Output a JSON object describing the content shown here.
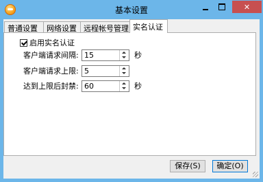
{
  "window": {
    "title": "基本设置",
    "controls": {
      "minimize_label": "",
      "maximize_label": "",
      "close_label": "✕"
    }
  },
  "tabs": [
    {
      "label": "普通设置"
    },
    {
      "label": "网络设置"
    },
    {
      "label": "远程帐号管理"
    },
    {
      "label": "实名认证"
    }
  ],
  "active_tab": "实名认证",
  "realname": {
    "enable_label": "启用实名认证",
    "enabled": true,
    "fields": [
      {
        "label": "客户端请求间隔:",
        "value": "15",
        "unit": "秒"
      },
      {
        "label": "客户端请求上限:",
        "value": "5",
        "unit": ""
      },
      {
        "label": "达到上限后封禁:",
        "value": "60",
        "unit": "秒"
      }
    ]
  },
  "buttons": {
    "save": "保存(S)",
    "ok": "确定(O)"
  },
  "colors": {
    "titlebar": "#6cb6e9",
    "close": "#c75050",
    "accent": "#0078d7"
  }
}
